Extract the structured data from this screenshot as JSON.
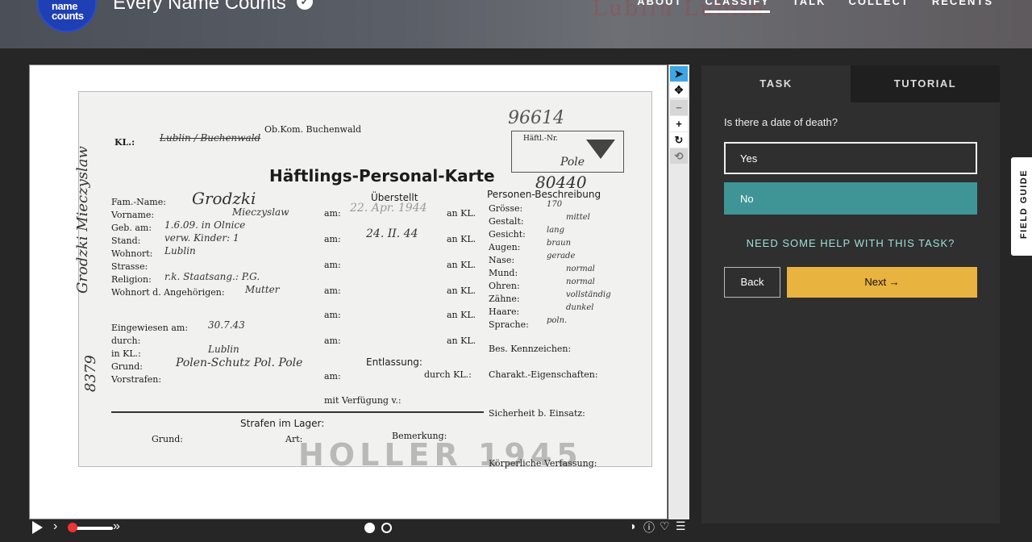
{
  "header": {
    "logo_text": "name counts",
    "title": "Every Name Counts",
    "nav": [
      "ABOUT",
      "CLASSIFY",
      "TALK",
      "COLLECT",
      "RECENTS"
    ],
    "active_nav": "CLASSIFY"
  },
  "card": {
    "title": "Häftlings-Personal-Karte",
    "kl_label": "KL.:",
    "kl_value": "Lublin / Buchenwald",
    "top_center": "Ob.Kom. Buchenwald",
    "top_number": "96614",
    "haeftl_label": "Häftl.-Nr.",
    "haeftl_value": "Pole",
    "second_number": "80440",
    "left_fields": [
      {
        "label": "Fam.-Name:",
        "value": "Grodzki"
      },
      {
        "label": "Vorname:",
        "value": "Mieczyslaw"
      },
      {
        "label": "Geb. am:",
        "value": "1.6.09. in Olnice"
      },
      {
        "label": "Stand:",
        "value": "verw.   Kinder: 1"
      },
      {
        "label": "Wohnort:",
        "value": "Lublin"
      },
      {
        "label": "Strasse:",
        "value": ""
      },
      {
        "label": "Religion:",
        "value": "r.k.   Staatsang.: P.G."
      },
      {
        "label": "Wohnort d. Angehörigen:",
        "value": "Mutter"
      },
      {
        "label": "Eingewiesen am:",
        "value": "30.7.43"
      },
      {
        "label": "durch:",
        "value": ""
      },
      {
        "label": "in KL.:",
        "value": "Lublin"
      },
      {
        "label": "Grund:",
        "value": "Polen-Schutz  Pol. Pole"
      },
      {
        "label": "Vorstrafen:",
        "value": ""
      }
    ],
    "ueberstellt_title": "Überstellt",
    "ueberstellt_rows": [
      {
        "am": "am:",
        "date": "22. Apr. 1944",
        "kl": "an KL."
      },
      {
        "am": "am:",
        "date": "24. II. 44",
        "kl": "an KL."
      },
      {
        "am": "am:",
        "date": "",
        "kl": "an KL."
      },
      {
        "am": "am:",
        "date": "",
        "kl": "an KL."
      },
      {
        "am": "am:",
        "date": "",
        "kl": "an KL."
      },
      {
        "am": "am:",
        "date": "",
        "kl": "an KL."
      }
    ],
    "entlassung_title": "Entlassung:",
    "entlassung_am": "am:",
    "entlassung_kl": "durch KL.:",
    "verfuegung": "mit Verfügung v.:",
    "person_title": "Personen-Beschreibung",
    "person_fields": [
      {
        "label": "Grösse:",
        "value": "170"
      },
      {
        "label": "Gestalt:",
        "value": "mittel"
      },
      {
        "label": "Gesicht:",
        "value": "lang"
      },
      {
        "label": "Augen:",
        "value": "braun"
      },
      {
        "label": "Nase:",
        "value": "gerade"
      },
      {
        "label": "Mund:",
        "value": "normal"
      },
      {
        "label": "Ohren:",
        "value": "normal"
      },
      {
        "label": "Zähne:",
        "value": "vollständig"
      },
      {
        "label": "Haare:",
        "value": "dunkel"
      },
      {
        "label": "Sprache:",
        "value": "poln."
      }
    ],
    "bes_kennzeichen": "Bes. Kennzeichen:",
    "charakt": "Charakt.-Eigenschaften:",
    "sicherheit": "Sicherheit b. Einsatz:",
    "koerperliche": "Körperliche Verfassung:",
    "strafen_title": "Strafen im Lager:",
    "strafen_cols": [
      "Grund:",
      "Art:",
      "Bemerkung:"
    ],
    "side_vertical": "Grodzki Mieczyslaw",
    "side_number": "8379"
  },
  "toolbar": {
    "tools": [
      "pointer-icon",
      "move-icon",
      "zoom-out-icon",
      "zoom-in-icon",
      "rotate-icon",
      "reset-icon"
    ]
  },
  "player": {
    "play": "play-icon",
    "prev": "›",
    "next": "»"
  },
  "task": {
    "tabs": [
      "TASK",
      "TUTORIAL"
    ],
    "active_tab": "TASK",
    "question": "Is there a date of death?",
    "answers": [
      "Yes",
      "No"
    ],
    "selected_answer": "No",
    "help": "NEED SOME HELP WITH THIS TASK?",
    "back": "Back",
    "next": "Next →"
  },
  "field_guide": "FIELD GUIDE",
  "colors": {
    "selected_answer": "#3f9595",
    "next_button": "#e8b33f",
    "active_tool": "#3da6e6",
    "help_link": "#9edfd8"
  }
}
